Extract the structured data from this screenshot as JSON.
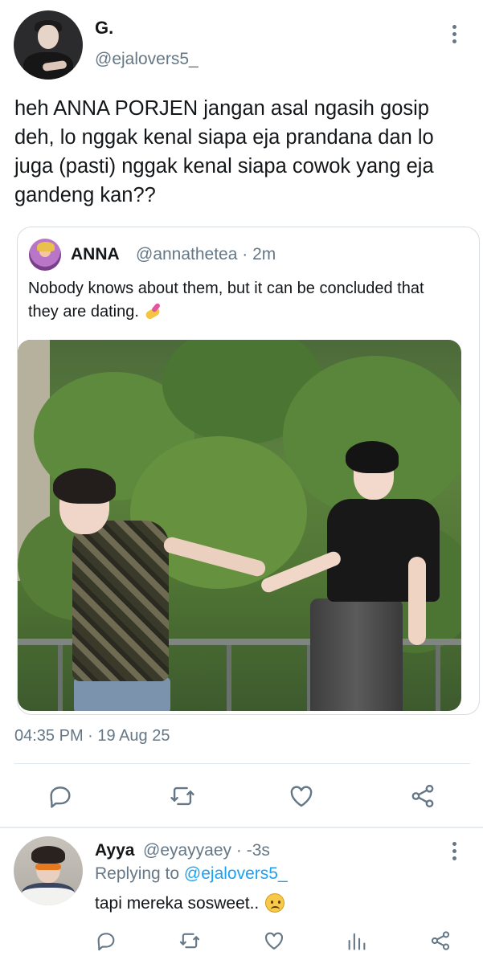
{
  "tweet": {
    "author_name": "G.",
    "author_handle": "@ejalovers5_",
    "text": "heh ANNA PORJEN jangan asal ngasih gosip deh, lo nggak kenal siapa eja prandana dan lo juga (pasti) nggak kenal siapa cowok yang eja gandeng kan??",
    "timestamp": "04:35 PM · 19 Aug 25",
    "quoted": {
      "author_name": "ANNA",
      "author_handle": "@annathetea · 2m",
      "text": "Nobody knows about them, but it can be concluded that they are dating.",
      "emoji": "nail-polish-emoji"
    },
    "actions": [
      "reply-icon",
      "retweet-icon",
      "like-icon",
      "share-icon"
    ]
  },
  "reply": {
    "author_name": "Ayya",
    "author_handle": "@eyayyaey · -3s",
    "replying_prefix": "Replying to",
    "replying_to": "@ejalovers5_",
    "text": "tapi mereka sosweet..",
    "emoji": "frowning-face-emoji",
    "actions": [
      "reply-icon",
      "retweet-icon",
      "like-icon",
      "analytics-icon",
      "share-icon"
    ]
  },
  "colors": {
    "text": "#14171a",
    "muted": "#657786",
    "link": "#1da1f2",
    "border": "#d7dde2"
  }
}
